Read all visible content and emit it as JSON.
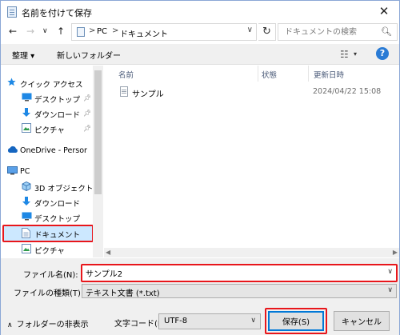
{
  "window": {
    "title": "名前を付けて保存",
    "close_glyph": "✕"
  },
  "nav": {
    "back_glyph": "←",
    "forward_glyph": "→",
    "recent_glyph": "∨",
    "up_glyph": "↑",
    "refresh_glyph": "↻"
  },
  "address": {
    "crumbs": [
      "PC",
      "ドキュメント"
    ],
    "sep": ">"
  },
  "search": {
    "placeholder": "ドキュメントの検索"
  },
  "toolbar": {
    "organize": "整理 ▾",
    "new_folder": "新しいフォルダー",
    "help": "?"
  },
  "sidebar": {
    "items": [
      {
        "label": "クイック アクセス",
        "icon": "star-icon",
        "pinned": false
      },
      {
        "label": "デスクトップ",
        "icon": "desktop-icon",
        "pinned": true
      },
      {
        "label": "ダウンロード",
        "icon": "download-icon",
        "pinned": true
      },
      {
        "label": "ピクチャ",
        "icon": "pictures-icon",
        "pinned": true
      },
      {
        "label": "OneDrive - Persor",
        "icon": "cloud-icon",
        "pinned": false
      },
      {
        "label": "PC",
        "icon": "pc-icon",
        "pinned": false
      },
      {
        "label": "3D オブジェクト",
        "icon": "cube-icon",
        "pinned": false
      },
      {
        "label": "ダウンロード",
        "icon": "download-icon",
        "pinned": false
      },
      {
        "label": "デスクトップ",
        "icon": "desktop-icon",
        "pinned": false
      },
      {
        "label": "ドキュメント",
        "icon": "document-icon",
        "pinned": false,
        "selected": true
      },
      {
        "label": "ピクチャ",
        "icon": "pictures-icon",
        "pinned": false
      }
    ]
  },
  "content": {
    "columns": [
      "名前",
      "状態",
      "更新日時"
    ],
    "files": [
      {
        "name": "サンプル",
        "date": "2024/04/22 15:08"
      }
    ]
  },
  "form": {
    "filename_label": "ファイル名(N):",
    "filename_value": "サンプル2",
    "filetype_label": "ファイルの種類(T):",
    "filetype_value": "テキスト文書 (*.txt)",
    "hide_folders": "フォルダーの非表示",
    "encoding_label": "文字コード(E):",
    "encoding_value": "UTF-8",
    "save": "保存(S)",
    "cancel": "キャンセル"
  },
  "colors": {
    "highlight_red": "#e8161b",
    "accent_blue": "#0078d7",
    "selection_bg": "#cce8ff"
  }
}
